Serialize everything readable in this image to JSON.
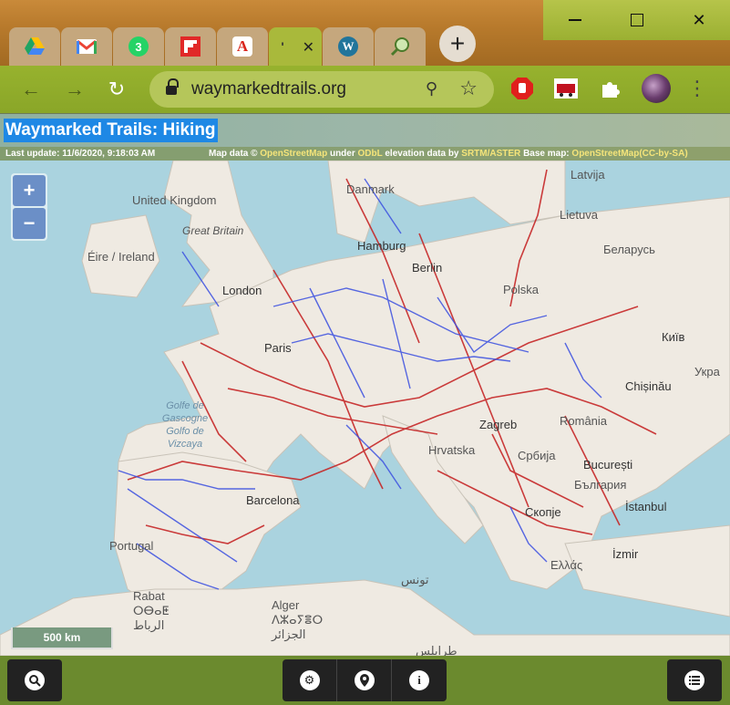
{
  "browser": {
    "tabs": [
      {
        "icon": "google-drive-icon",
        "color": "#1fa463"
      },
      {
        "icon": "gmail-icon",
        "label": "M",
        "color": "#ea4335"
      },
      {
        "icon": "whatsapp-icon",
        "label": "3",
        "color": "#25d366"
      },
      {
        "icon": "flipboard-icon",
        "color": "#e12828"
      },
      {
        "icon": "acrobat-icon",
        "label": "A",
        "color": "#d9251c"
      },
      {
        "icon": "loading-icon",
        "label": "'",
        "active": true
      },
      {
        "icon": "wordpress-icon",
        "label": "W",
        "color": "#21759b"
      },
      {
        "icon": "magnifier-tab-icon",
        "color": "#7aa858"
      }
    ],
    "new_tab_label": "+",
    "url": "waymarkedtrails.org"
  },
  "site": {
    "title": "Waymarked Trails: Hiking",
    "last_update": "Last update: 11/6/2020, 9:18:03 AM",
    "attribution": {
      "map_data": "Map data ©",
      "osm": "OpenStreetMap",
      "under": "under",
      "odbl": "ODbL",
      "elevation": "elevation data by",
      "srtm": "SRTM/ASTER",
      "base": "Base map:",
      "osm2": "OpenStreetMap",
      "license": "(CC-by-SA)"
    }
  },
  "map": {
    "zoom_in": "+",
    "zoom_out": "−",
    "scale": "500 km",
    "labels": {
      "uk": "United Kingdom",
      "gb": "Great Britain",
      "ireland": "Éire / Ireland",
      "london": "London",
      "danmark": "Danmark",
      "latvija": "Latvija",
      "lietuva": "Lietuva",
      "belarus": "Беларусь",
      "hamburg": "Hamburg",
      "berlin": "Berlin",
      "polska": "Polska",
      "kyiv": "Київ",
      "ukraine": "Укра",
      "paris": "Paris",
      "chisinau": "Chișinău",
      "romania": "România",
      "zagreb": "Zagreb",
      "hrvatska": "Hrvatska",
      "srbija": "Србија",
      "golfe": "Golfe de Gascogne Golfo de Vizcaya",
      "bucuresti": "București",
      "bulgaria": "България",
      "istanbul": "İstanbul",
      "skopje": "Скопје",
      "barcelona": "Barcelona",
      "portugal": "Portugal",
      "izmir": "İzmir",
      "ellas": "Ελλάς",
      "tunis": "تونس",
      "rabat": "Rabat ⵔⴱⴰⵟ الرباط",
      "alger": "Alger ⴷⵣⴰⵢⴻⵔ الجزائر",
      "tripoli": "طرابلس"
    }
  },
  "bottom": {
    "search_icon": "search-icon",
    "settings_icon": "gear-icon",
    "location_icon": "map-pin-icon",
    "info_icon": "info-icon",
    "list_icon": "list-icon"
  }
}
